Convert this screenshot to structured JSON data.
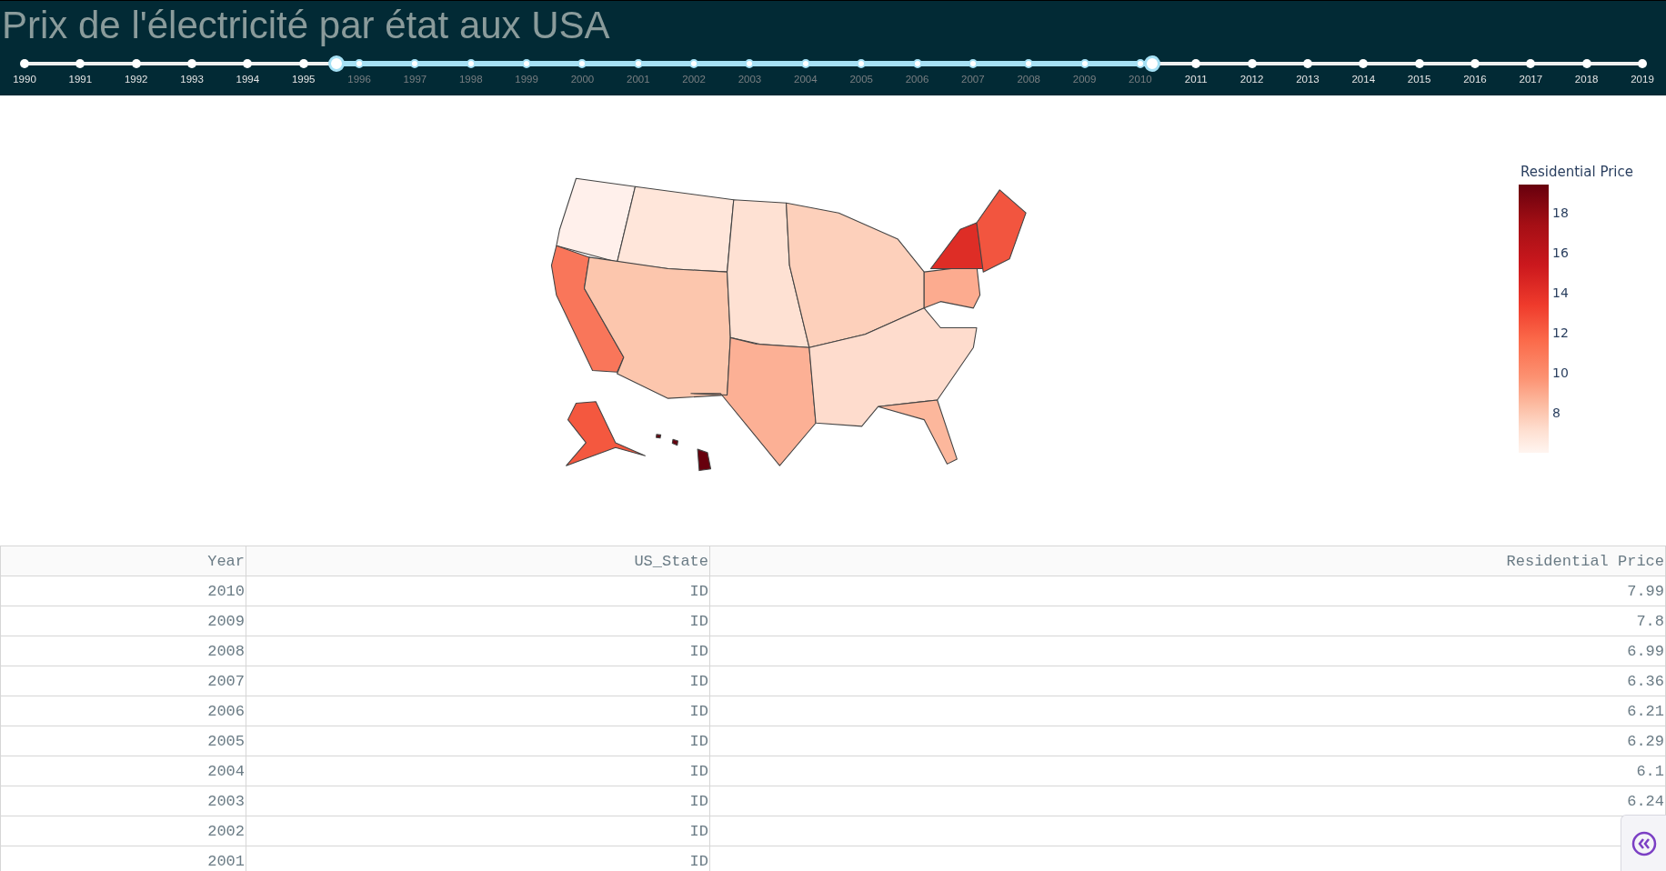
{
  "header": {
    "title": "Prix de l'électricité par état aux USA"
  },
  "year_slider": {
    "handles": [
      {
        "level": 0.193
      },
      {
        "level": 0.697
      }
    ],
    "marks": [
      {
        "label": "1990",
        "in_range": false
      },
      {
        "label": "1991",
        "in_range": false
      },
      {
        "label": "1992",
        "in_range": false
      },
      {
        "label": "1993",
        "in_range": false
      },
      {
        "label": "1994",
        "in_range": false
      },
      {
        "label": "1995",
        "in_range": false
      },
      {
        "label": "1996",
        "in_range": true
      },
      {
        "label": "1997",
        "in_range": true
      },
      {
        "label": "1998",
        "in_range": true
      },
      {
        "label": "1999",
        "in_range": true
      },
      {
        "label": "2000",
        "in_range": true
      },
      {
        "label": "2001",
        "in_range": true
      },
      {
        "label": "2002",
        "in_range": true
      },
      {
        "label": "2003",
        "in_range": true
      },
      {
        "label": "2004",
        "in_range": true
      },
      {
        "label": "2005",
        "in_range": true
      },
      {
        "label": "2006",
        "in_range": true
      },
      {
        "label": "2007",
        "in_range": true
      },
      {
        "label": "2008",
        "in_range": true
      },
      {
        "label": "2009",
        "in_range": true
      },
      {
        "label": "2010",
        "in_range": true
      },
      {
        "label": "2011",
        "in_range": false
      },
      {
        "label": "2012",
        "in_range": false
      },
      {
        "label": "2013",
        "in_range": false
      },
      {
        "label": "2014",
        "in_range": false
      },
      {
        "label": "2015",
        "in_range": false
      },
      {
        "label": "2016",
        "in_range": false
      },
      {
        "label": "2017",
        "in_range": false
      },
      {
        "label": "2018",
        "in_range": false
      },
      {
        "label": "2019",
        "in_range": false
      }
    ]
  },
  "map": {
    "colorbar": {
      "title": "Residential Price",
      "ticks": [
        "18",
        "16",
        "14",
        "12",
        "10",
        "8"
      ]
    }
  },
  "table": {
    "columns": [
      "Year",
      "US_State",
      "Residential Price"
    ],
    "rows": [
      [
        "2010",
        "ID",
        "7.99"
      ],
      [
        "2009",
        "ID",
        "7.8"
      ],
      [
        "2008",
        "ID",
        "6.99"
      ],
      [
        "2007",
        "ID",
        "6.36"
      ],
      [
        "2006",
        "ID",
        "6.21"
      ],
      [
        "2005",
        "ID",
        "6.29"
      ],
      [
        "2004",
        "ID",
        "6.1"
      ],
      [
        "2003",
        "ID",
        "6.24"
      ],
      [
        "2002",
        "ID"
      ],
      [
        "2001",
        "ID"
      ]
    ]
  }
}
